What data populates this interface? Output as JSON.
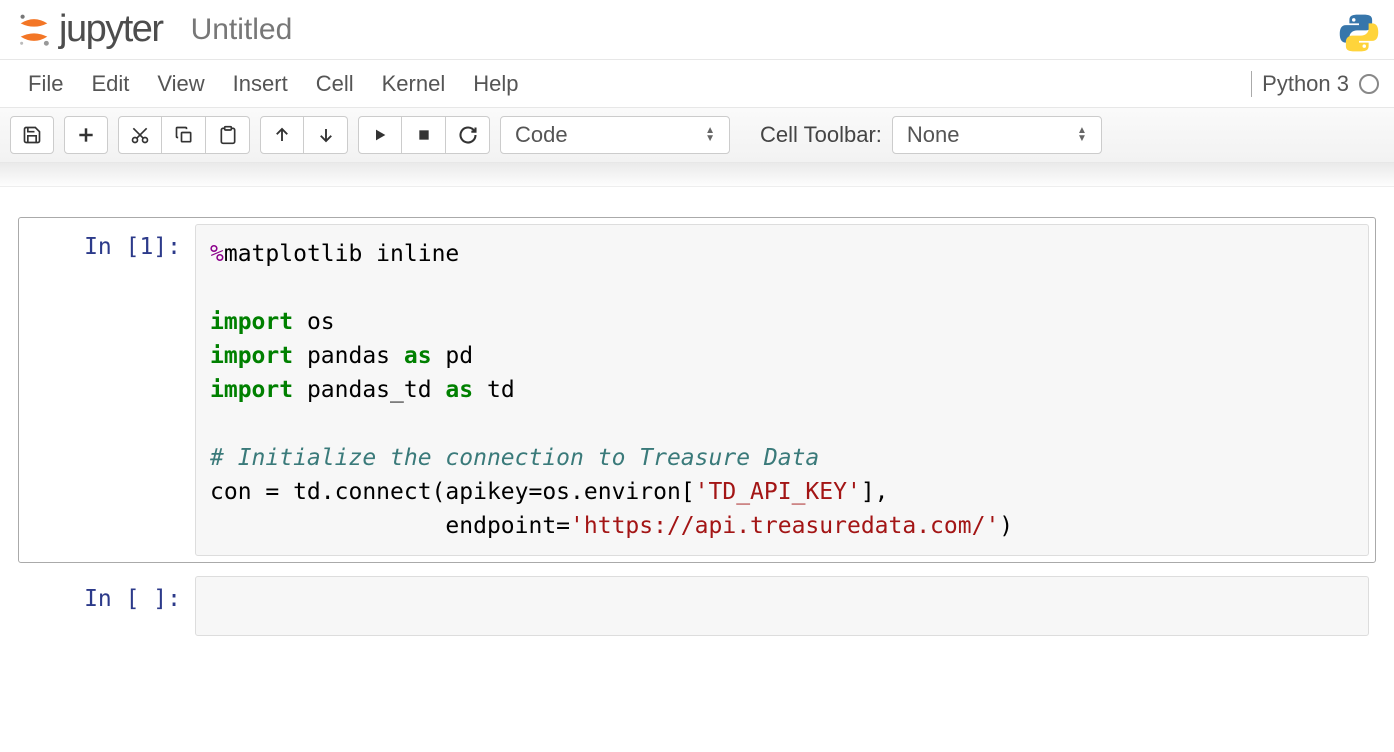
{
  "header": {
    "logo_text": "jupyter",
    "notebook_title": "Untitled"
  },
  "menubar": {
    "items": [
      "File",
      "Edit",
      "View",
      "Insert",
      "Cell",
      "Kernel",
      "Help"
    ],
    "kernel_name": "Python 3"
  },
  "toolbar": {
    "cell_type_selected": "Code",
    "cell_toolbar_label": "Cell Toolbar:",
    "cell_toolbar_selected": "None"
  },
  "cells": [
    {
      "prompt": "In [1]:",
      "code_html": "<span class=\"cm-magic\">%</span>matplotlib inline\n\n<span class=\"cm-keyword\">import</span> os\n<span class=\"cm-keyword\">import</span> pandas <span class=\"cm-keyword\">as</span> pd\n<span class=\"cm-keyword\">import</span> pandas_td <span class=\"cm-keyword\">as</span> td\n\n<span class=\"cm-comment\"># Initialize the connection to Treasure Data</span>\ncon = td.connect(apikey=os.environ[<span class=\"cm-string\">'TD_API_KEY'</span>],\n                 endpoint=<span class=\"cm-string\">'https://api.treasuredata.com/'</span>)",
      "selected": true
    },
    {
      "prompt": "In [ ]:",
      "code_html": "",
      "selected": false
    }
  ]
}
